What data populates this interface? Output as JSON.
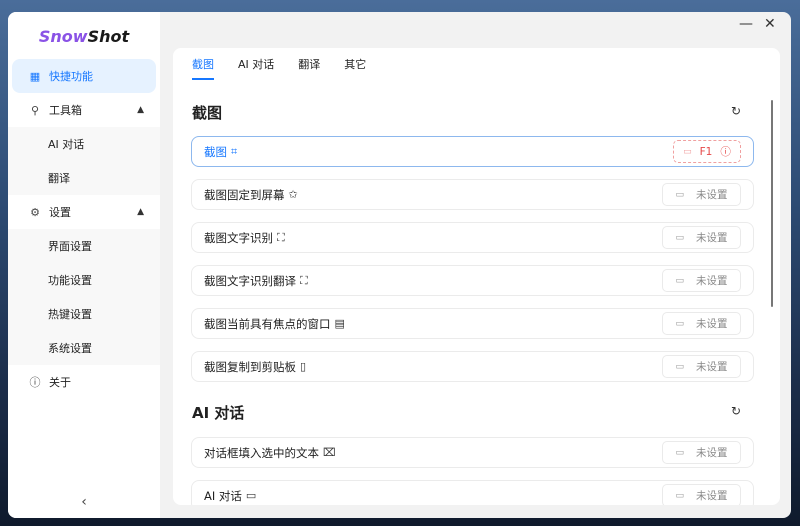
{
  "app": {
    "logo_part1": "Snow",
    "logo_part2": "Shot"
  },
  "window": {
    "minimize": "—",
    "close": "✕"
  },
  "sidebar": {
    "items": [
      {
        "label": "快捷功能",
        "icon": "grid-icon",
        "active": true
      },
      {
        "label": "工具箱",
        "icon": "wrench-icon",
        "expanded": true,
        "children": [
          "AI 对话",
          "翻译"
        ]
      },
      {
        "label": "设置",
        "icon": "gear-icon",
        "expanded": true,
        "children": [
          "界面设置",
          "功能设置",
          "热键设置",
          "系统设置"
        ]
      },
      {
        "label": "关于",
        "icon": "info-icon"
      }
    ],
    "collapse": "‹"
  },
  "tabs": [
    "截图",
    "AI 对话",
    "翻译",
    "其它"
  ],
  "active_tab": 0,
  "sections": [
    {
      "title": "截图",
      "rows": [
        {
          "label": "截图",
          "icon": "crop-icon",
          "key": "F1",
          "conflict": true
        },
        {
          "label": "截图固定到屏幕",
          "icon": "pin-icon",
          "key": "未设置"
        },
        {
          "label": "截图文字识别",
          "icon": "scan-text-icon",
          "key": "未设置"
        },
        {
          "label": "截图文字识别翻译",
          "icon": "translate-scan-icon",
          "key": "未设置"
        },
        {
          "label": "截图当前具有焦点的窗口",
          "icon": "window-icon",
          "key": "未设置"
        },
        {
          "label": "截图复制到剪贴板",
          "icon": "clipboard-icon",
          "key": "未设置"
        }
      ]
    },
    {
      "title": "AI 对话",
      "rows": [
        {
          "label": "对话框填入选中的文本",
          "icon": "text-select-icon",
          "key": "未设置"
        },
        {
          "label": "AI 对话",
          "icon": "chat-icon",
          "key": "未设置"
        }
      ]
    }
  ],
  "colors": {
    "accent": "#1677ff",
    "logo_purple": "#8a52e6",
    "error": "#e54848"
  }
}
